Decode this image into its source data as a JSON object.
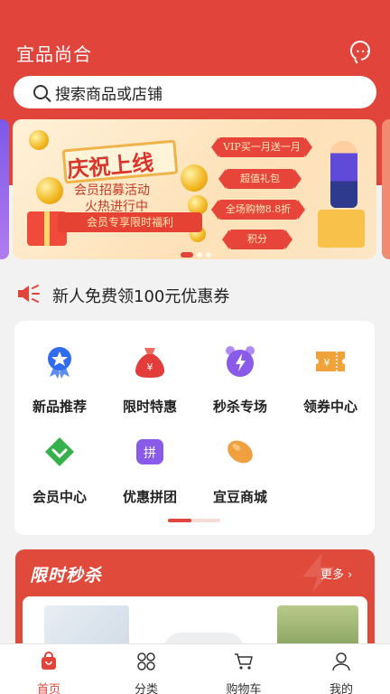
{
  "header": {
    "app_title": "宜品尚合",
    "chat_icon": "chat-bubble-icon"
  },
  "search": {
    "placeholder": "搜索商品或店铺",
    "icon": "search-icon"
  },
  "banner": {
    "title": "庆祝上线",
    "subtitle_1": "会员招募活动",
    "subtitle_2": "火热进行中",
    "benefit_text": "会员专享限时福利",
    "tags": [
      "VIP买一月送一月",
      "超值礼包",
      "全场购物8.8折",
      "积分"
    ],
    "slide_count": 3,
    "active_slide": 1
  },
  "notice": {
    "icon": "speaker-icon",
    "text": "新人免费领100元优惠券"
  },
  "categories": [
    {
      "label": "新品推荐",
      "icon": "medal-icon",
      "color": "#2f6cf0"
    },
    {
      "label": "限时特惠",
      "icon": "money-bag-icon",
      "color": "#e23d3a"
    },
    {
      "label": "秒杀专场",
      "icon": "alarm-clock-icon",
      "color": "#8a5be8"
    },
    {
      "label": "领券中心",
      "icon": "coupon-icon",
      "color": "#f0a33a"
    },
    {
      "label": "会员中心",
      "icon": "diamond-icon",
      "color": "#35b04a"
    },
    {
      "label": "优惠拼团",
      "icon": "group-buy-icon",
      "color": "#8a5be8"
    },
    {
      "label": "宜豆商城",
      "icon": "bean-icon",
      "color": "#f0a040"
    }
  ],
  "flash_sale": {
    "title": "限时秒杀",
    "more_label": "更多 ›"
  },
  "tabbar": {
    "items": [
      {
        "label": "首页",
        "icon": "home-bag-icon",
        "active": true
      },
      {
        "label": "分类",
        "icon": "category-grid-icon",
        "active": false
      },
      {
        "label": "购物车",
        "icon": "cart-icon",
        "active": false
      },
      {
        "label": "我的",
        "icon": "user-icon",
        "active": false
      }
    ]
  },
  "colors": {
    "brand": "#e0443a",
    "background": "#f2f2f2"
  }
}
